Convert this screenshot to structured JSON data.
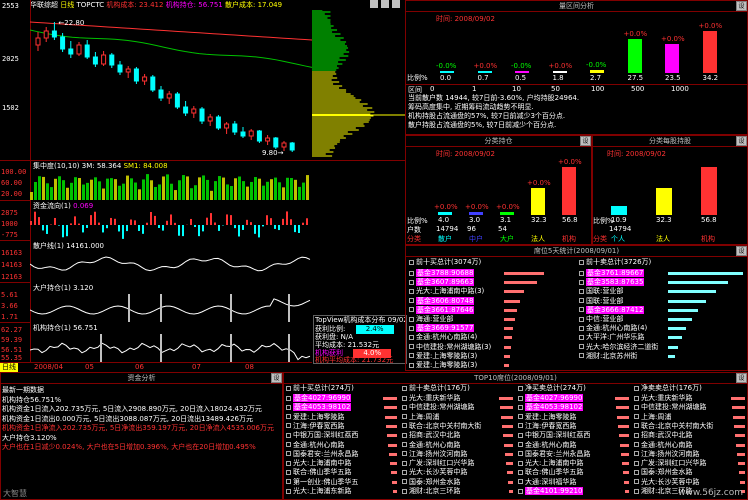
{
  "header": {
    "stock_name": "华联综超",
    "period": "日线",
    "indicator": "TOPCTC",
    "inst_cost": "机构成本: 23.412",
    "inst_hold": "机构持仓: 56.751",
    "retail_cost": "散户成本: 17.049"
  },
  "kline": {
    "yticks": [
      "2553",
      "2025",
      "1502"
    ],
    "max_label": "22.80",
    "min_label": "9.80",
    "candles": [
      [
        20.5,
        21.8,
        19.9,
        21.2
      ],
      [
        21.2,
        22.3,
        20.8,
        21.9
      ],
      [
        21.9,
        22.8,
        21.0,
        21.3
      ],
      [
        21.3,
        21.7,
        19.8,
        20.1
      ],
      [
        20.1,
        20.9,
        19.2,
        19.6
      ],
      [
        19.6,
        20.8,
        19.4,
        20.5
      ],
      [
        20.5,
        21.0,
        19.1,
        19.3
      ],
      [
        19.3,
        19.8,
        18.3,
        18.6
      ],
      [
        18.6,
        19.9,
        18.4,
        19.5
      ],
      [
        19.5,
        19.7,
        18.2,
        18.5
      ],
      [
        18.5,
        18.9,
        17.5,
        17.8
      ],
      [
        17.8,
        18.4,
        17.2,
        18.1
      ],
      [
        18.1,
        18.3,
        16.6,
        16.9
      ],
      [
        16.9,
        17.6,
        16.5,
        17.3
      ],
      [
        17.3,
        17.5,
        15.8,
        16.0
      ],
      [
        16.0,
        16.4,
        14.9,
        15.2
      ],
      [
        15.2,
        15.9,
        14.6,
        15.6
      ],
      [
        15.6,
        15.8,
        14.1,
        14.3
      ],
      [
        14.3,
        14.9,
        13.4,
        13.7
      ],
      [
        13.7,
        14.4,
        13.2,
        14.1
      ],
      [
        14.1,
        14.3,
        12.6,
        12.9
      ],
      [
        12.9,
        13.6,
        12.4,
        13.3
      ],
      [
        13.3,
        13.5,
        12.0,
        12.2
      ],
      [
        12.2,
        12.8,
        11.6,
        12.6
      ],
      [
        12.6,
        12.9,
        11.5,
        11.8
      ],
      [
        11.8,
        12.3,
        11.2,
        11.4
      ],
      [
        11.4,
        12.1,
        11.0,
        11.9
      ],
      [
        11.9,
        12.0,
        10.7,
        10.9
      ],
      [
        10.9,
        11.5,
        10.5,
        11.2
      ],
      [
        11.2,
        11.3,
        10.1,
        10.3
      ],
      [
        10.3,
        10.9,
        9.9,
        10.7
      ],
      [
        10.7,
        10.8,
        9.8,
        10.0
      ]
    ]
  },
  "chip_icons": [
    "ruler-icon",
    "grid-icon",
    "book-icon"
  ],
  "ind": {
    "jzd_label": "集中度(10,10)",
    "jzd_v1": "3M: 58.364",
    "jzd_v2": "SM1: 84.008",
    "jzd_ticks": [
      "100.00",
      "60.00",
      "20.00"
    ],
    "zjlx_label": "资金流向(1)",
    "zjlx_val": "0.069",
    "zjlx_ticks": [
      "2875",
      "1000",
      "-775"
    ],
    "sh_label": "散户线(1)",
    "sh_val": "14161.000",
    "sh_ticks": [
      "16163",
      "14163",
      "12163"
    ],
    "dh_label": "大户持仓(1)",
    "dh_val": "3.120",
    "dh_ticks": [
      "5.61",
      "3.66",
      "1.71"
    ],
    "jg_label": "机构持仓(1)",
    "jg_val": "56.751",
    "jg_ticks": [
      "62.27",
      "59.39",
      "56.51",
      "55.35"
    ]
  },
  "timeline": {
    "labels": [
      "2008/04",
      "05",
      "06",
      "07",
      "08"
    ],
    "tab": "日线"
  },
  "inst_popup": {
    "title": "TopView机构成本分布 09/02",
    "rows": [
      {
        "k": "获利比例:",
        "v": "2.4%"
      },
      {
        "k": "获利盘:",
        "v": "N/A"
      },
      {
        "k": "平均成本:",
        "v": "21.532元"
      },
      {
        "k": "机构获利",
        "v": "4.0%"
      }
    ],
    "footer": "机构平均成本: 21.732元"
  },
  "range_panel": {
    "title": "量区间分析",
    "date_label": "时间: 2008/09/02",
    "bars": [
      {
        "pct": "-0.0%",
        "val": "0.0",
        "pc": "#00ff00",
        "c": "#00ffff",
        "v": 0.0
      },
      {
        "pct": "+0.0%",
        "val": "0.7",
        "pc": "#ff3232",
        "c": "#00ffff",
        "v": 0.7
      },
      {
        "pct": "-0.0%",
        "val": "0.5",
        "pc": "#00ff00",
        "c": "#ff00ff",
        "v": 0.5
      },
      {
        "pct": "+0.0%",
        "val": "1.8",
        "pc": "#ff3232",
        "c": "#ffffff",
        "v": 1.8
      },
      {
        "pct": "-0.0%",
        "val": "2.7",
        "pc": "#00ff00",
        "c": "#ffff00",
        "v": 2.7
      },
      {
        "pct": "+0.0%",
        "val": "27.5",
        "pc": "#ff3232",
        "c": "#00ff00",
        "v": 27.5
      },
      {
        "pct": "+0.0%",
        "val": "23.5",
        "pc": "#ff3232",
        "c": "#ff00ff",
        "v": 23.5
      },
      {
        "pct": "+0.0%",
        "val": "34.2",
        "pc": "#ff3232",
        "c": "#ff3232",
        "v": 34.2
      }
    ],
    "row_label": "比例%",
    "axis_label": "区间",
    "xticks": [
      "0",
      "1",
      "10",
      "50",
      "100",
      "500",
      "1000"
    ],
    "desc": [
      "当前散户数 14944, 较7日前-3.60%, 户均持股24964.",
      "筹码高度集中, 近期筹码流动趋势不明显.",
      "机构持股占流通盘的57%, 较7日前减少3个百分点.",
      "散户持股占流通盘的5%, 较7日前减少个百分点."
    ]
  },
  "hold_panel": {
    "title": "分类持仓",
    "date_label": "时间: 2008/09/02",
    "bars": [
      {
        "val": "4.0",
        "pct": "+0.0%",
        "c": "#00ffff",
        "v": 4.0
      },
      {
        "val": "3.0",
        "pct": "+0.0%",
        "c": "#4040ff",
        "v": 3.0
      },
      {
        "val": "3.1",
        "pct": "+0.0%",
        "c": "#00ff00",
        "v": 3.1
      },
      {
        "val": "32.3",
        "pct": "+0.0%",
        "c": "#ffff00",
        "v": 32.3
      },
      {
        "val": "56.8",
        "pct": "+0.0%",
        "c": "#ff3232",
        "v": 56.8
      }
    ],
    "row_label": "比例%",
    "num_label": "户数",
    "nums": [
      "14794",
      "96",
      "54",
      "",
      ""
    ],
    "cats": [
      "散户",
      "中户",
      "大户",
      "法人",
      "机构"
    ],
    "cat_label": "分类"
  },
  "trade_panel": {
    "title": "分类每股持股",
    "date_label": "时间: 2008/09/02",
    "bars": [
      {
        "val": "10.9",
        "c": "#00ffff",
        "v": 10.9
      },
      {
        "val": "32.3",
        "c": "#ffff00",
        "v": 32.3
      },
      {
        "val": "56.8",
        "c": "#ff3232",
        "v": 56.8
      }
    ],
    "row_label": "比例%",
    "nums": [
      "14794",
      "",
      ""
    ],
    "cats": [
      "个人",
      "法人",
      "机构"
    ],
    "cat_label": "分类"
  },
  "seat_panel": {
    "title": "席位5天统计(2008/09/01)",
    "left_header": "前十买总计(3074万)",
    "right_header": "前十卖总计(3726万)",
    "left": [
      {
        "t": "基金3788:90688",
        "hl": true,
        "w": 40
      },
      {
        "t": "基金3607:89663",
        "hl": true,
        "w": 33
      },
      {
        "t": "光大:上海浦南中路(3)",
        "hl": false,
        "w": 20
      },
      {
        "t": "基金3606:80748",
        "hl": true,
        "w": 16
      },
      {
        "t": "基金3661:87646",
        "hl": true,
        "w": 13
      },
      {
        "t": "海通:营业部",
        "hl": false,
        "w": 11
      },
      {
        "t": "基金3669:91577",
        "hl": true,
        "w": 9
      },
      {
        "t": "金通:杭州心南路(4)",
        "hl": false,
        "w": 8
      },
      {
        "t": "中信建投:常州湖塘路(3)",
        "hl": false,
        "w": 7
      },
      {
        "t": "爱建:上海零陵路(3)",
        "hl": false,
        "w": 6
      },
      {
        "t": "爱建:上海零陵路(3)",
        "hl": false,
        "w": 5
      }
    ],
    "right": [
      {
        "t": "基金3761:89667",
        "hl": true,
        "w": 75
      },
      {
        "t": "基金3583:87635",
        "hl": true,
        "w": 60
      },
      {
        "t": "国联:营业部",
        "hl": false,
        "w": 48
      },
      {
        "t": "国联:营业部",
        "hl": false,
        "w": 38
      },
      {
        "t": "基金3666:87412",
        "hl": true,
        "w": 30
      },
      {
        "t": "中信:营业部",
        "hl": false,
        "w": 24
      },
      {
        "t": "金通:杭州心南路(4)",
        "hl": false,
        "w": 18
      },
      {
        "t": "大平洋:广州华乐路",
        "hl": false,
        "w": 14
      },
      {
        "t": "光大:哈尔滨经济二道街",
        "hl": false,
        "w": 10
      },
      {
        "t": "湘财:北京苏州街",
        "hl": false,
        "w": 7
      }
    ]
  },
  "capital_panel": {
    "title": "资金分析",
    "lines": [
      {
        "t": "最新一期数据",
        "c": "white"
      },
      {
        "t": "机构持仓56.751%",
        "c": "white"
      },
      {
        "t": "机构资金1日流入202.735万元, 5日流入2908.890万元, 20日流入18024.432万元",
        "c": "white"
      },
      {
        "t": "机构资金1日流出0.000万元, 5日流出3088.087万元, 20日流出13489.426万元",
        "c": "white"
      },
      {
        "t": "机构资金1日净流入202.735万元, 5日净流出359.197万元, 20日净流入4535.006万元",
        "c": "red"
      },
      {
        "t": "大户持仓3.120%",
        "c": "white"
      },
      {
        "t": "大户也在1日减少0.024%, 大户也在5日增加0.396%, 大户也在20日增加0.495%",
        "c": "red"
      }
    ]
  },
  "top10_panel": {
    "title": "TOP10席位(2008/09/01)",
    "cols": [
      {
        "header": "前十买总计(274万)",
        "rows": [
          {
            "t": "基金4027:96990",
            "hl": true
          },
          {
            "t": "基金4053:98102",
            "hl": true
          },
          {
            "t": "爱建:上海零陵路",
            "hl": false
          },
          {
            "t": "江海:伊春宽西路",
            "hl": false
          },
          {
            "t": "中银万国:深圳红荔西",
            "hl": false
          },
          {
            "t": "金通:杭州心南路",
            "hl": false
          },
          {
            "t": "国泰君安:兰州永昌路",
            "hl": false
          },
          {
            "t": "光大:上海浦南中路",
            "hl": false
          },
          {
            "t": "联合:佛山季华五路",
            "hl": false
          },
          {
            "t": "第一创业:佛山季华五",
            "hl": false
          },
          {
            "t": "光大:上海浦东新路",
            "hl": false
          }
        ]
      },
      {
        "header": "前十卖总计(176万)",
        "rows": [
          {
            "t": "光大:重庆新华路",
            "hl": false
          },
          {
            "t": "中信建投:常州湖塘路",
            "hl": false
          },
          {
            "t": "上海:周浦",
            "hl": false
          },
          {
            "t": "联合:北京中关村南大街",
            "hl": false
          },
          {
            "t": "招商:武汉中北路",
            "hl": false
          },
          {
            "t": "金通:杭州心南路",
            "hl": false
          },
          {
            "t": "江海:扬州汶河南路",
            "hl": false
          },
          {
            "t": "广发:深圳红口兴华路",
            "hl": false
          },
          {
            "t": "光大:长沙芙蓉中路",
            "hl": false
          },
          {
            "t": "国泰:郑州金水路",
            "hl": false
          },
          {
            "t": "湘财:北京三环路",
            "hl": false
          }
        ]
      },
      {
        "header": "净买卖总计(274万)",
        "rows": [
          {
            "t": "基金4027:96990",
            "hl": true
          },
          {
            "t": "基金4053:98102",
            "hl": true
          },
          {
            "t": "爱建:上海零陵路",
            "hl": false
          },
          {
            "t": "江海:伊春宽西路",
            "hl": false
          },
          {
            "t": "中银万国:深圳红荔西",
            "hl": false
          },
          {
            "t": "金通:杭州心南路",
            "hl": false
          },
          {
            "t": "国泰君安:兰州永昌路",
            "hl": false
          },
          {
            "t": "光大:上海浦南中路",
            "hl": false
          },
          {
            "t": "联合:佛山季华五路",
            "hl": false
          },
          {
            "t": "大通:深圳福华路",
            "hl": false
          },
          {
            "t": "基金4101:99210",
            "hl": true
          }
        ]
      },
      {
        "header": "净卖卖总计(176万)",
        "rows": [
          {
            "t": "光大:重庆新华路",
            "hl": false
          },
          {
            "t": "中信建投:常州湖塘路",
            "hl": false
          },
          {
            "t": "上海:周浦",
            "hl": false
          },
          {
            "t": "联合:北京中关村南大街",
            "hl": false
          },
          {
            "t": "招商:武汉中北路",
            "hl": false
          },
          {
            "t": "金通:杭州心南路",
            "hl": false
          },
          {
            "t": "江海:扬州汶河南路",
            "hl": false
          },
          {
            "t": "广发:深圳红口兴华路",
            "hl": false
          },
          {
            "t": "国泰:郑州金水路",
            "hl": false
          },
          {
            "t": "光大:长沙芙蓉中路",
            "hl": false
          },
          {
            "t": "湘财:北京三环路",
            "hl": false
          }
        ]
      }
    ]
  },
  "settings_label": "设",
  "watermark_left": "大智慧",
  "watermark_right": "www.56jz.com"
}
